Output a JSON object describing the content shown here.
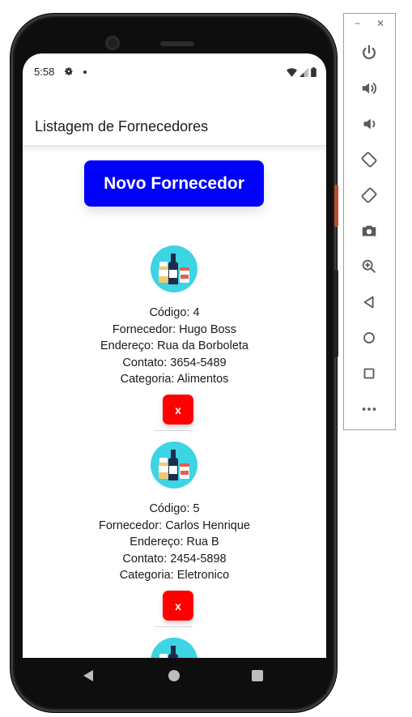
{
  "status_bar": {
    "time": "5:58",
    "icons": [
      "gear-icon",
      "dot-icon",
      "wifi-icon",
      "signal-icon",
      "battery-icon"
    ]
  },
  "app_bar": {
    "title": "Listagem de Fornecedores"
  },
  "new_supplier_button": {
    "label": "Novo Fornecedor",
    "color": "#0000ff"
  },
  "suppliers": [
    {
      "code_line": "Código: 4",
      "supplier_line": "Fornecedor: Hugo Boss",
      "address_line": "Endereço: Rua da Borboleta",
      "contact_line": "Contato: 3654-5489",
      "category_line": "Categoria: Alimentos",
      "delete_label": "x"
    },
    {
      "code_line": "Código: 5",
      "supplier_line": "Fornecedor: Carlos Henrique",
      "address_line": "Endereço: Rua B",
      "contact_line": "Contato: 2454-5898",
      "category_line": "Categoria: Eletronico",
      "delete_label": "x"
    }
  ],
  "colors": {
    "accent_blue": "#0000ff",
    "delete_red": "#ff0000",
    "avatar_cyan": "#3dd4e4"
  },
  "emulator_toolbar": {
    "window_controls": [
      "minimize-icon",
      "close-icon"
    ],
    "buttons": [
      "power-icon",
      "volume-up-icon",
      "volume-down-icon",
      "rotate-left-icon",
      "rotate-right-icon",
      "camera-icon",
      "zoom-icon",
      "back-icon",
      "home-icon",
      "overview-icon",
      "more-icon"
    ]
  }
}
